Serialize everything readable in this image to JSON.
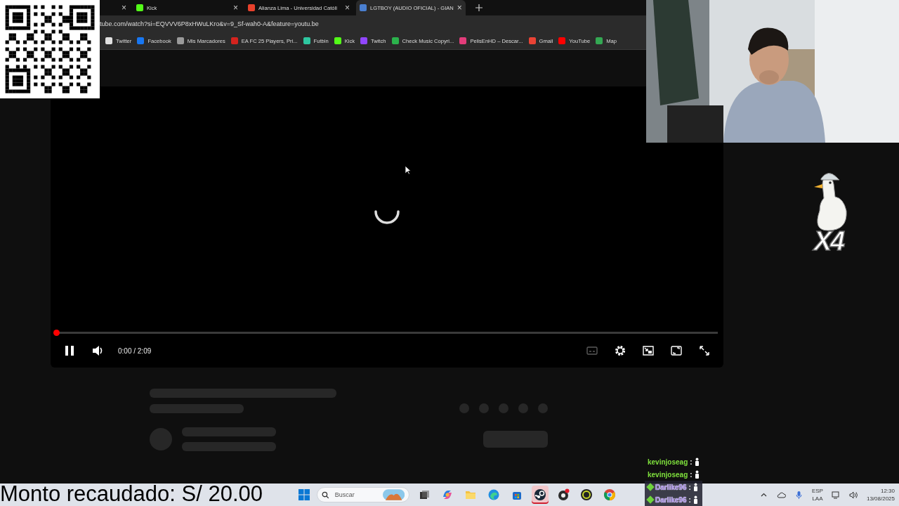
{
  "tabs": [
    {
      "selected": false,
      "close": "×"
    },
    {
      "title": "Kick",
      "selected": false,
      "color": "#53fc18",
      "close": "×"
    },
    {
      "title": "Alianza Lima - Universidad Católi",
      "selected": false,
      "color": "#e8412c",
      "close": "×"
    },
    {
      "title": "LGTBOY (AUDIO OFICIAL) - GIAN",
      "selected": true,
      "color": "#4a7fd0",
      "close": "×"
    }
  ],
  "address": "tube.com/watch?si=EQVVV6P8xHWuLKro&v=9_Sf-wah0-A&feature=youtu.be",
  "bookmarks": [
    {
      "label": "Twitter",
      "color": "#e0e0e0"
    },
    {
      "label": "Facebook",
      "color": "#1877f2"
    },
    {
      "label": "Mis Marcadores",
      "color": "#9a9a9a"
    },
    {
      "label": "EA FC 25 Players, Pri...",
      "color": "#d4231e"
    },
    {
      "label": "Futbin",
      "color": "#2ec7a0"
    },
    {
      "label": "Kick",
      "color": "#53fc18"
    },
    {
      "label": "Twitch",
      "color": "#9146ff"
    },
    {
      "label": "Check Music Copyri...",
      "color": "#2bb24c"
    },
    {
      "label": "PelisEnHD – Descar...",
      "color": "#e23c7a"
    },
    {
      "label": "Gmail",
      "color": "#ea4335"
    },
    {
      "label": "YouTube",
      "color": "#ff0000"
    },
    {
      "label": "Map",
      "color": "#34a853"
    }
  ],
  "player": {
    "level": 0,
    "time": "0:00 / 2:09",
    "captions_disabled": true
  },
  "sticker": {
    "multiplier": "X4"
  },
  "chat": [
    {
      "user": "kevinjoseag",
      "sep": ":",
      "color": "#7ee03c",
      "badge": false
    },
    {
      "user": "kevinjoseag",
      "sep": ":",
      "color": "#7ee03c",
      "badge": false
    },
    {
      "user": "Darlike96",
      "sep": ":",
      "color": "#a58ae6",
      "badge": true
    },
    {
      "user": "Darlike96",
      "sep": ":",
      "color": "#a58ae6",
      "badge": true
    }
  ],
  "donation": "Monto recaudado: S/ 20.00",
  "taskbar": {
    "search_placeholder": "Buscar",
    "apps": [
      {
        "kind": "taskview",
        "selected": false
      },
      {
        "kind": "copilot",
        "selected": false
      },
      {
        "kind": "folder",
        "selected": false
      },
      {
        "kind": "edge",
        "selected": false
      },
      {
        "kind": "store",
        "selected": false
      },
      {
        "kind": "steam",
        "selected": true
      },
      {
        "kind": "record",
        "selected": false
      },
      {
        "kind": "ring",
        "selected": false
      },
      {
        "kind": "chrome",
        "selected": false
      }
    ],
    "lang": "ESP",
    "layout": "LAA",
    "time": "12:30",
    "date": "13/08/2025"
  }
}
